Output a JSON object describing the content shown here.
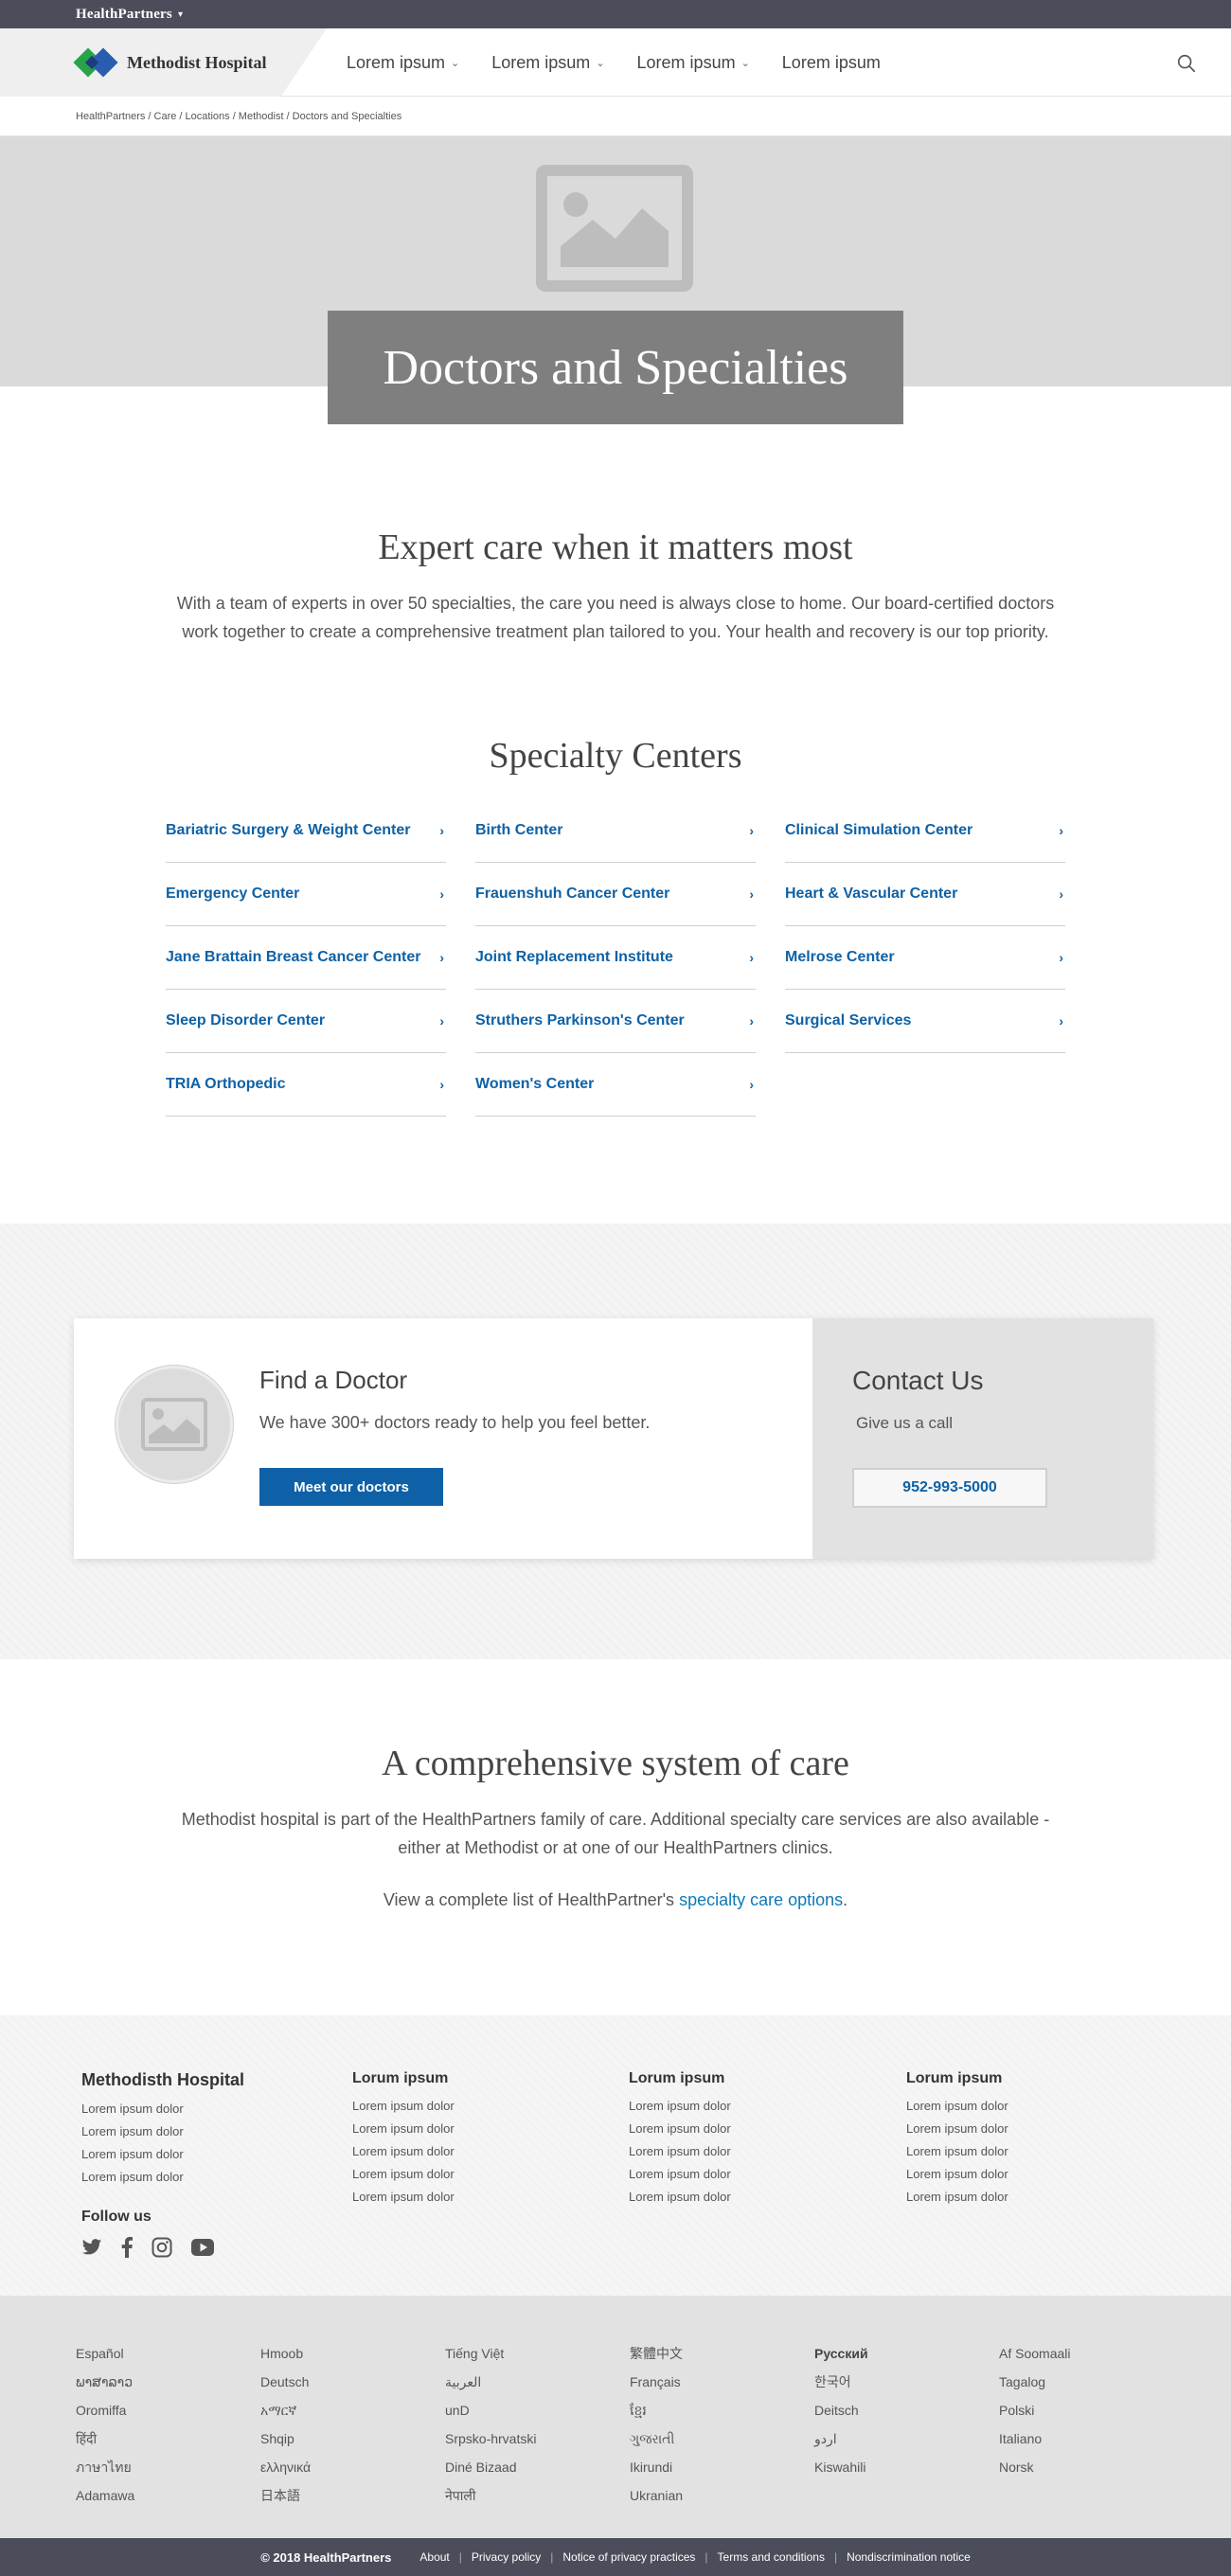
{
  "topbar": {
    "brand": "HealthPartners"
  },
  "nav": {
    "logo_text": "Methodist Hospital",
    "items": [
      {
        "label": "Lorem ipsum",
        "caret": true
      },
      {
        "label": "Lorem ipsum",
        "caret": true
      },
      {
        "label": "Lorem ipsum",
        "caret": true
      },
      {
        "label": "Lorem ipsum",
        "caret": false
      }
    ]
  },
  "breadcrumb": "HealthPartners / Care / Locations / Methodist / Doctors and Specialties",
  "hero": {
    "title": "Doctors and Specialties"
  },
  "intro": {
    "heading": "Expert care when it matters most",
    "text": "With a team of experts in over 50 specialties, the care you need is always close to home. Our board-certified doctors work together to create a comprehensive treatment plan tailored to you. Your health and recovery is our top priority."
  },
  "centers": {
    "heading": "Specialty Centers",
    "items": [
      "Bariatric Surgery & Weight Center",
      "Birth Center",
      "Clinical Simulation Center",
      "Emergency Center",
      "Frauenshuh Cancer Center",
      "Heart & Vascular Center",
      "Jane Brattain Breast Cancer Center",
      "Joint Replacement Institute",
      "Melrose Center",
      "Sleep Disorder Center",
      "Struthers Parkinson's Center",
      "Surgical Services",
      "TRIA Orthopedic",
      "Women's Center"
    ]
  },
  "find_doctor": {
    "title": "Find a Doctor",
    "text": "We have 300+ doctors ready to help you feel better.",
    "button": "Meet our doctors"
  },
  "contact": {
    "title": "Contact Us",
    "text": "Give us a call",
    "phone": "952-993-5000"
  },
  "system": {
    "heading": "A comprehensive system of care",
    "text": "Methodist hospital is part of the HealthPartners family of care. Additional specialty care services are also available - either at Methodist or at one of our HealthPartners clinics.",
    "link_prefix": "View a complete list of HealthPartner's ",
    "link_text": "specialty care options",
    "link_suffix": "."
  },
  "footer": {
    "col1": {
      "title": "Methodisth Hospital",
      "items": [
        "Lorem ipsum dolor",
        "Lorem ipsum dolor",
        "Lorem ipsum dolor",
        "Lorem ipsum dolor"
      ]
    },
    "col2": {
      "title": "Lorum ipsum",
      "items": [
        "Lorem ipsum dolor",
        "Lorem ipsum dolor",
        "Lorem ipsum dolor",
        "Lorem ipsum dolor",
        "Lorem ipsum dolor"
      ]
    },
    "col3": {
      "title": "Lorum ipsum",
      "items": [
        "Lorem ipsum dolor",
        "Lorem ipsum dolor",
        "Lorem ipsum dolor",
        "Lorem ipsum dolor",
        "Lorem ipsum dolor"
      ]
    },
    "col4": {
      "title": "Lorum ipsum",
      "items": [
        "Lorem ipsum dolor",
        "Lorem ipsum dolor",
        "Lorem ipsum dolor",
        "Lorem ipsum dolor",
        "Lorem ipsum dolor"
      ]
    },
    "follow": "Follow us",
    "social": [
      "twitter-icon",
      "facebook-icon",
      "instagram-icon",
      "youtube-icon"
    ]
  },
  "languages": [
    [
      "Español",
      "ພາສາລາວ",
      "Oromiffa",
      "हिंदी",
      "ภาษาไทย",
      "Adamawa"
    ],
    [
      "Hmoob",
      "Deutsch",
      "አማርኛ",
      "Shqip",
      "ελληνικά",
      "日本語"
    ],
    [
      "Tiếng Việt",
      "العربية",
      "unD",
      "Srpsko-hrvatski",
      "Diné Bizaad",
      "नेपाली"
    ],
    [
      "繁體中文",
      "Français",
      "ខ្មែរ",
      "ગુજરાતી",
      "Ikirundi",
      "Ukranian"
    ],
    [
      "Русский",
      "한국어",
      "Deitsch",
      "اردو",
      "Kiswahili"
    ],
    [
      "Af Soomaali",
      "Tagalog",
      "Polski",
      "Italiano",
      "Norsk"
    ]
  ],
  "bottom": {
    "copyright": "© 2018 HealthPartners",
    "links": [
      "About",
      "Privacy policy",
      "Notice of privacy practices",
      "Terms and conditions",
      "Nondiscrimination notice"
    ]
  },
  "colors": {
    "brand_blue": "#0e61a6",
    "dark_bar": "#4b4e5a",
    "hero_gray": "#dadada"
  }
}
